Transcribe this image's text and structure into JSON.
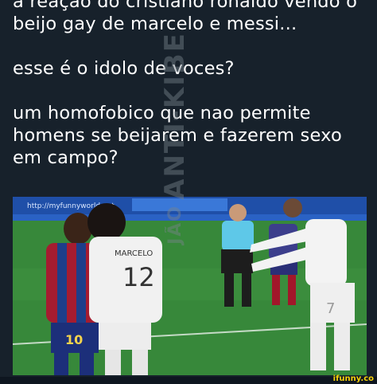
{
  "caption": {
    "paragraph1": "a reação do cristiano ronaldo vendo o beijo gay de marcelo e messi...",
    "paragraph2": "esse é o idolo de voces?",
    "paragraph3": "um homofobico que nao permite homens se beijarem e fazerem sexo em campo?"
  },
  "watermark": {
    "brand": "ANTI-KIBE",
    "name": "JÃO"
  },
  "photo": {
    "banner_url": "http://myfunnyworld.net",
    "left_player_number": "10",
    "center_player_name": "MARCELO",
    "center_player_number": "12",
    "right_player_number": "7"
  },
  "footer": {
    "logo": "ifunny.co"
  },
  "colors": {
    "background": "#17212b",
    "text": "#ffffff",
    "pitch": "#2f7a2c",
    "logo": "#f5d10a"
  }
}
